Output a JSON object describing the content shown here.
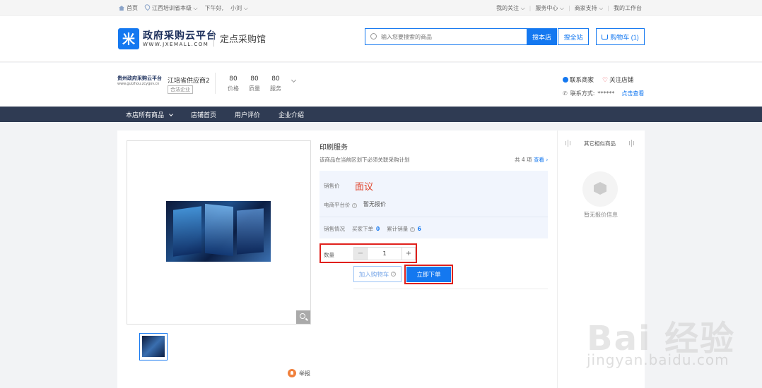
{
  "topbar": {
    "home": "首页",
    "location": "江西培训省本级",
    "greeting": "下午好,",
    "user": "小刘",
    "links": [
      "我的关注",
      "服务中心",
      "商家支持",
      "我的工作台"
    ]
  },
  "header": {
    "logo_mark": "米",
    "logo_title": "政府采购云平台",
    "logo_url": "WWW.JXEMALL.COM",
    "section": "定点采购馆",
    "search_placeholder": "输入您要搜索的商品",
    "search_store": "搜本店",
    "search_all": "搜全站",
    "cart": "购物车 (1)"
  },
  "store": {
    "logo_title": "贵州政府采购云平台",
    "logo_url": "www.guizhou.zcygov.cn",
    "name": "江培省供应商2",
    "badge": "合法企业",
    "scores": [
      {
        "value": "80",
        "label": "价格"
      },
      {
        "value": "80",
        "label": "质量"
      },
      {
        "value": "80",
        "label": "服务"
      }
    ],
    "contact_seller": "联系商家",
    "follow": "关注店铺",
    "contact_label": "联系方式:",
    "contact_masked": "******",
    "contact_view": "点击查看"
  },
  "nav": {
    "items": [
      "本店所有商品",
      "店铺首页",
      "用户评价",
      "企业介绍"
    ]
  },
  "product": {
    "title": "印刷服务",
    "note": "该商品在当前区划下必须关联采购计划",
    "count_prefix": "共 4 项",
    "count_link": "查看",
    "price_label": "销售价",
    "price_value": "面议",
    "ref_label": "电商平台价",
    "ref_value": "暂无报价",
    "sales_label": "销售情况",
    "buyer_orders_label": "买家下单",
    "buyer_orders_value": "0",
    "total_sales_label": "累计销量",
    "total_sales_value": "6",
    "qty_label": "数量",
    "qty_value": "1",
    "minus": "−",
    "plus": "+",
    "add_cart": "加入购物车",
    "buy_now": "立即下单",
    "report": "举报"
  },
  "side": {
    "title": "其它相似商品",
    "empty": "暂无报价信息"
  },
  "watermark": {
    "main": "Bai 经验",
    "sub": "jingyan.baidu.com"
  },
  "colors": {
    "accent": "#1478f0",
    "nav_bg": "#2f3b53",
    "price": "#e0442c",
    "highlight": "#e0201c"
  }
}
